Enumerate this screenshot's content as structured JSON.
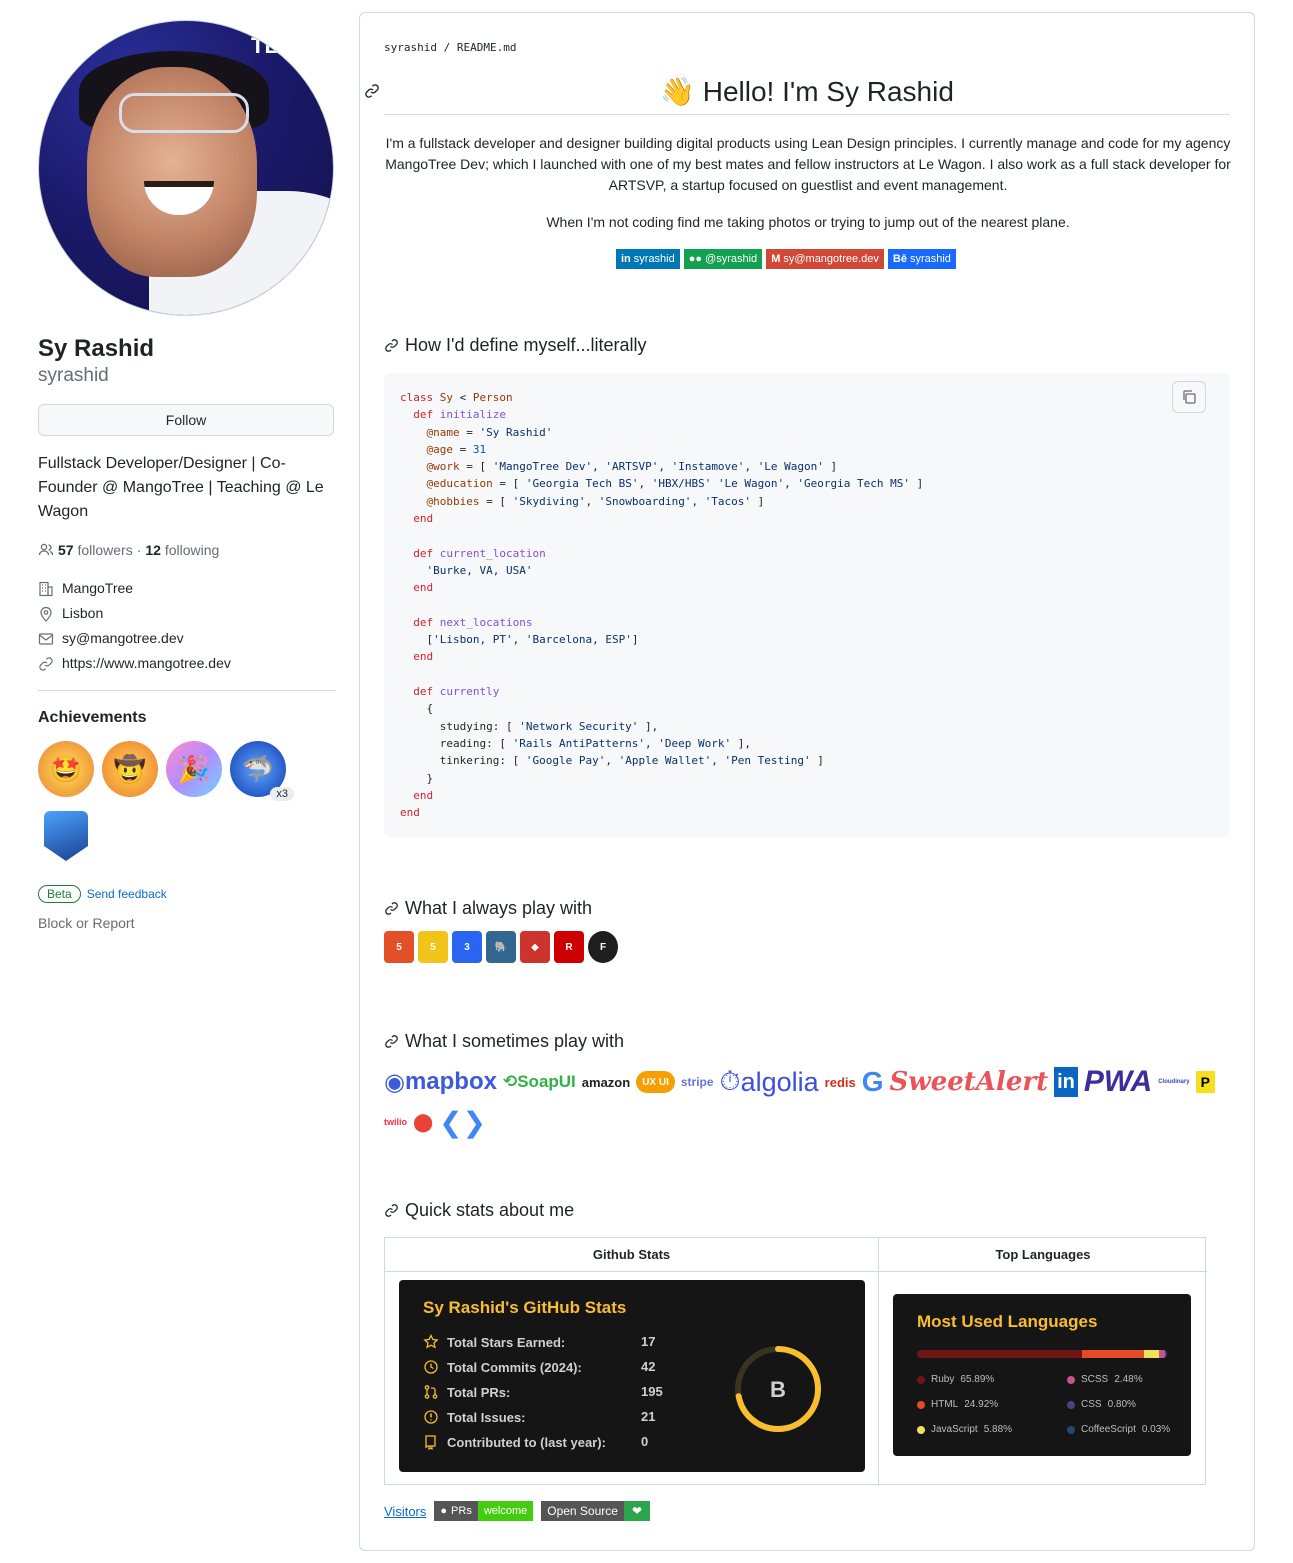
{
  "profile": {
    "name": "Sy Rashid",
    "login": "syrashid",
    "follow_label": "Follow",
    "bio": "Fullstack Developer/Designer | Co-Founder @ MangoTree | Teaching @ Le Wagon",
    "followers_count": "57",
    "followers_label": "followers",
    "separator": "·",
    "following_count": "12",
    "following_label": "following",
    "company": "MangoTree",
    "location": "Lisbon",
    "email": "sy@mangotree.dev",
    "website": "https://www.mangotree.dev"
  },
  "achievements": {
    "title": "Achievements",
    "extra_count": "x3",
    "beta_label": "Beta",
    "feedback_label": "Send feedback",
    "block_label": "Block or Report"
  },
  "readme": {
    "path_user": "syrashid",
    "path_sep": "/",
    "path_file": "README.md",
    "hello": "Hello! I'm Sy Rashid",
    "intro": "I'm a fullstack developer and designer building digital products using Lean Design principles. I currently manage and code for my agency MangoTree Dev; which I launched with one of my best mates and fellow instructors at Le Wagon. I also work as a full stack developer for ARTSVP, a startup focused on guestlist and event management.",
    "hobby_line": "When I'm not coding find me taking photos or trying to jump out of the nearest plane.",
    "shields": [
      {
        "label": "syrashid",
        "icon": "in",
        "color": "#0077b5"
      },
      {
        "label": "@syrashid",
        "icon": "●●",
        "color": "#12a150"
      },
      {
        "label": "sy@mangotree.dev",
        "icon": "M",
        "color": "#d14836"
      },
      {
        "label": "syrashid",
        "icon": "Bē",
        "color": "#1769ff"
      }
    ],
    "h_define": "How I'd define myself...literally",
    "h_always": "What I always play with",
    "h_sometimes": "What I sometimes play with",
    "h_stats": "Quick stats about me",
    "always_icons": [
      {
        "name": "html5-icon",
        "text": "5",
        "color": "#e34f26"
      },
      {
        "name": "js-icon",
        "text": "5",
        "color": "#f0c419"
      },
      {
        "name": "css3-icon",
        "text": "3",
        "color": "#2965f1"
      },
      {
        "name": "postgresql-icon",
        "text": "🐘",
        "color": "#336791"
      },
      {
        "name": "ruby-icon",
        "text": "◆",
        "color": "#cc342d"
      },
      {
        "name": "rails-icon",
        "text": "R",
        "color": "#cc0000"
      },
      {
        "name": "figma-icon",
        "text": "F",
        "color": "#1e1e1e"
      }
    ],
    "sometimes_logos": [
      {
        "name": "mapbox-logo",
        "text": "mapbox",
        "color": "#3b5bdb"
      },
      {
        "name": "soapui-logo",
        "text": "SoapUI",
        "color": "#2fb344"
      },
      {
        "name": "aws-logo",
        "text": "amazon",
        "color": "#222222"
      },
      {
        "name": "uxui-logo",
        "text": "UX UI",
        "color": "#f59f00"
      },
      {
        "name": "stripe-logo",
        "text": "stripe",
        "color": "#6772e5"
      },
      {
        "name": "algolia-logo",
        "text": "algolia",
        "color": "#3c4fe0"
      },
      {
        "name": "redis-logo",
        "text": "redis",
        "color": "#d82c20"
      },
      {
        "name": "google-logo",
        "text": "G",
        "color": "#4285f4"
      },
      {
        "name": "sweetalert-logo",
        "text": "SweetAlert",
        "color": "#e8545a"
      },
      {
        "name": "linkedin-logo",
        "text": "in",
        "color": "#0a66c2"
      },
      {
        "name": "pwa-logo",
        "text": "PWA",
        "color": "#3d2e9e"
      },
      {
        "name": "cloudinary-logo",
        "text": "Cloudinary",
        "color": "#3448c5"
      },
      {
        "name": "twilio-logo",
        "text": "twilio",
        "color": "#f22f46"
      },
      {
        "name": "google-maps-logo",
        "text": "⬤",
        "color": "#ea4335"
      }
    ]
  },
  "stats": {
    "col1_header": "Github Stats",
    "col2_header": "Top Languages",
    "card_title": "Sy Rashid's GitHub Stats",
    "rows": [
      {
        "label": "Total Stars Earned:",
        "value": "17"
      },
      {
        "label": "Total Commits (2024):",
        "value": "42"
      },
      {
        "label": "Total PRs:",
        "value": "195"
      },
      {
        "label": "Total Issues:",
        "value": "21"
      },
      {
        "label": "Contributed to (last year):",
        "value": "0"
      }
    ],
    "rank": "B",
    "rank_progress": 0.72,
    "lang_title": "Most Used Languages",
    "languages": [
      {
        "name": "Ruby",
        "pct": "65.89%",
        "value": 65.89,
        "color": "#701516"
      },
      {
        "name": "HTML",
        "pct": "24.92%",
        "value": 24.92,
        "color": "#e34c26"
      },
      {
        "name": "JavaScript",
        "pct": "5.88%",
        "value": 5.88,
        "color": "#f1e05a"
      },
      {
        "name": "SCSS",
        "pct": "2.48%",
        "value": 2.48,
        "color": "#c6538c"
      },
      {
        "name": "CSS",
        "pct": "0.80%",
        "value": 0.8,
        "color": "#563d7c"
      },
      {
        "name": "CoffeeScript",
        "pct": "0.03%",
        "value": 0.03,
        "color": "#244776"
      }
    ]
  },
  "footer": {
    "visitors": "Visitors",
    "prs_label": "PRs",
    "prs_value": "welcome",
    "os_label": "Open Source"
  },
  "colors": {
    "accent": "#0969da",
    "card_bg": "#151515",
    "card_title": "#fabd2f"
  }
}
